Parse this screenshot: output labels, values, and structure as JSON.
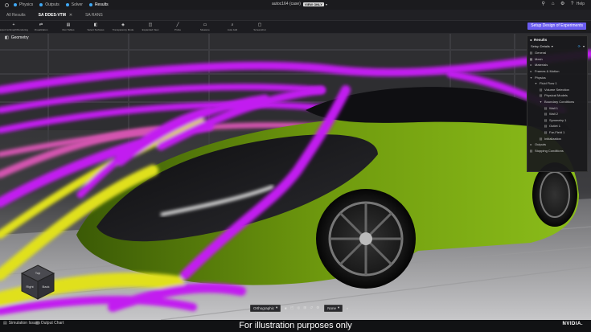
{
  "topbar": {
    "nav": [
      {
        "label": "Physics",
        "color": "#3fa9f5"
      },
      {
        "label": "Outputs",
        "color": "#3fa9f5"
      },
      {
        "label": "Solver",
        "color": "#3fa9f5"
      },
      {
        "label": "Results",
        "color": "#3fa9f5"
      }
    ],
    "file_title": "autoc164 (case) ",
    "view_only": "VIEW ONLY",
    "help": "Help"
  },
  "tabs": [
    {
      "label": "All Results"
    },
    {
      "label": "SA DDES-VTM",
      "close": "✕"
    },
    {
      "label": "SA RANS"
    }
  ],
  "toolbar": {
    "tools": [
      {
        "icon": "+",
        "label": "Export to/Graph/Rendering"
      },
      {
        "icon": "⇄",
        "label": "Visualization"
      },
      {
        "icon": "▤",
        "label": "Run Tables"
      },
      {
        "icon": "◧",
        "label": "Select Surfaces"
      },
      {
        "icon": "◈",
        "label": "Transparency Mode"
      },
      {
        "icon": "◫",
        "label": "Expanded View"
      },
      {
        "icon": "╱",
        "label": "Probe"
      },
      {
        "icon": "▭",
        "label": "Measure"
      },
      {
        "icon": "⌕",
        "label": "Auto Add"
      },
      {
        "icon": "▢",
        "label": "Screenshot"
      }
    ],
    "setup_button": "Setup Design of Experiments"
  },
  "viewport": {
    "geometry_label": "Geometry"
  },
  "results_panel": {
    "title": "Results",
    "setup_details": "Setup Details",
    "tree": [
      {
        "label": "General",
        "indent": 1,
        "icon": "▤"
      },
      {
        "label": "Mesh",
        "indent": 1,
        "icon": "▦"
      },
      {
        "label": "Materials",
        "indent": 1,
        "icon": "▸"
      },
      {
        "label": "Frames & Motion",
        "indent": 1,
        "icon": "▸"
      },
      {
        "label": "Physics",
        "indent": 1,
        "icon": "▾"
      },
      {
        "label": "Fluid Flow 1",
        "indent": 2,
        "icon": "▾"
      },
      {
        "label": "Volume Selection",
        "indent": 3,
        "icon": "▤"
      },
      {
        "label": "Physical Models",
        "indent": 3,
        "icon": "▤"
      },
      {
        "label": "Boundary Conditions",
        "indent": 3,
        "icon": "▾"
      },
      {
        "label": "Wall 1",
        "indent": 4,
        "icon": "▤"
      },
      {
        "label": "Wall 2",
        "indent": 4,
        "icon": "▤"
      },
      {
        "label": "Symmetry 1",
        "indent": 4,
        "icon": "▤"
      },
      {
        "label": "Outlet 1",
        "indent": 4,
        "icon": "▤"
      },
      {
        "label": "Far-Field 1",
        "indent": 4,
        "icon": "▤"
      },
      {
        "label": "Initialization",
        "indent": 3,
        "icon": "▤"
      },
      {
        "label": "Outputs",
        "indent": 1,
        "icon": "▸"
      },
      {
        "label": "Stopping Conditions",
        "indent": 1,
        "icon": "▤"
      }
    ]
  },
  "view_controls": {
    "projection": "Orthographic",
    "shading": "None"
  },
  "bottombar": {
    "simulation_issues": "Simulation Issues",
    "output_chart": "Output Chart",
    "caption": "For illustration purposes only",
    "brand": "NVIDIA."
  },
  "nav_cube": {
    "top": "Top",
    "right": "Back",
    "left": "Right"
  },
  "colors": {
    "accent": "#6a5cf0",
    "streamline_magenta": "#c21cf0",
    "streamline_yellow": "#e0e01a",
    "car_body": "#6f9a0e"
  }
}
